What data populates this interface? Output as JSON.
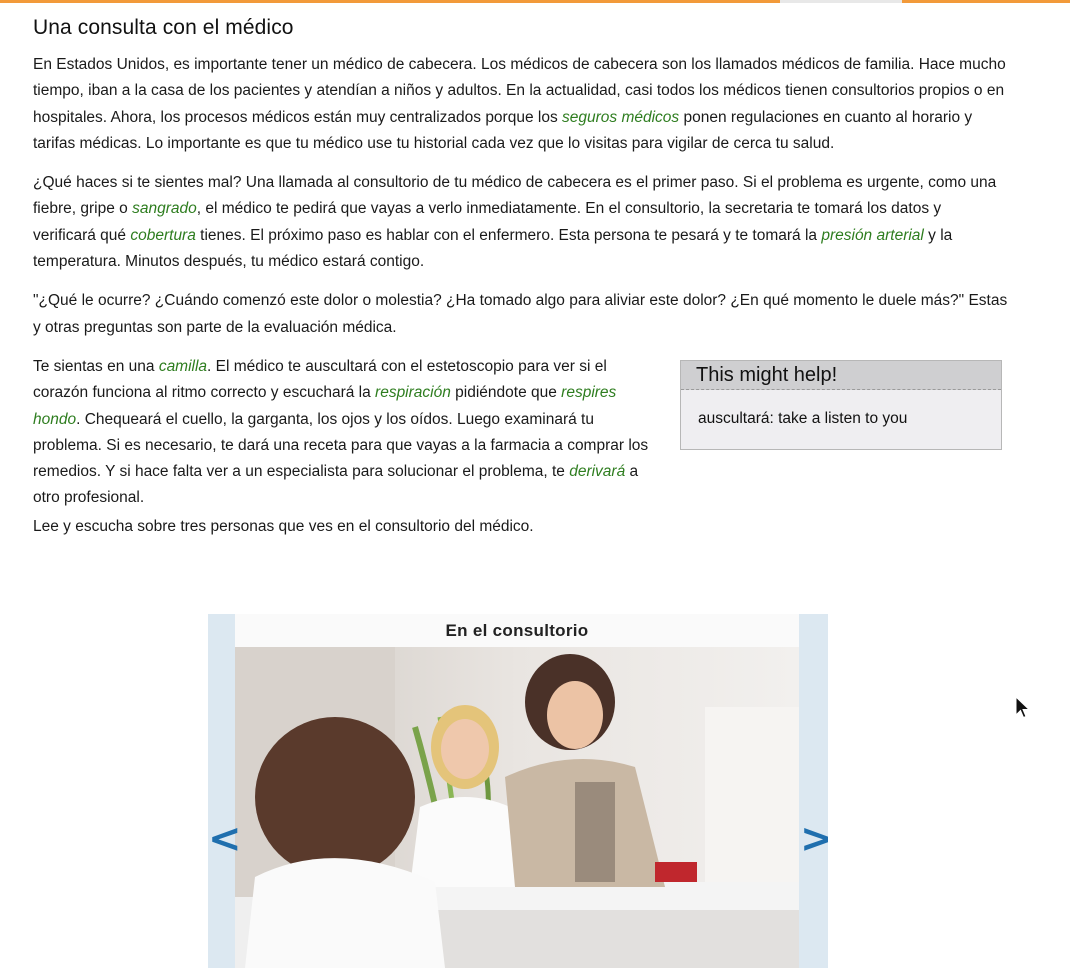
{
  "page": {
    "title": "Una consulta con el médico"
  },
  "paragraphs": {
    "p1": {
      "s1": "En Estados Unidos, es importante tener un médico de cabecera. Los médicos de cabecera son los llamados médicos de familia. Hace mucho tiempo, iban a la casa de los pacientes y atendían a niños y adultos. En la actualidad, casi todos los médicos tienen consultorios propios o en hospitales. Ahora, los procesos médicos están muy centralizados porque los ",
      "g1": "seguros médicos",
      "s2": " ponen regulaciones en cuanto al horario y tarifas médicas. Lo importante es que tu médico use tu historial cada vez que lo visitas para vigilar de cerca tu salud."
    },
    "p2": {
      "s1": "¿Qué haces si te sientes mal? Una llamada al consultorio de tu médico de cabecera es el primer paso. Si el problema es urgente, como una fiebre, gripe o ",
      "g1": "sangrado",
      "s2": ", el médico te pedirá que vayas a verlo inmediatamente. En el consultorio, la secretaria te tomará los datos y verificará qué ",
      "g2": "cobertura",
      "s3": " tienes. El próximo paso es hablar con el enfermero. Esta persona te pesará y te tomará la ",
      "g3": "presión arterial",
      "s4": " y la temperatura. Minutos después, tu médico estará contigo."
    },
    "p3": "\"¿Qué le ocurre? ¿Cuándo comenzó este dolor o molestia? ¿Ha tomado algo para aliviar este dolor? ¿En qué momento le duele más?\" Estas y otras preguntas son parte de la evaluación médica.",
    "p4": {
      "s1": "Te sientas en una ",
      "g1": "camilla",
      "s2": ". El médico te auscultará con el estetoscopio para ver si el corazón funciona al ritmo correcto y escuchará la ",
      "g2": "respiración",
      "s3": " pidiéndote que ",
      "g3": "respires hondo",
      "s4": ". Chequeará el cuello, la garganta, los ojos y los oídos. Luego examinará tu problema. Si es necesario, te dará una receta para que vayas a la farmacia a comprar los remedios. Y si hace falta ver a un especialista para solucionar el problema, te ",
      "g4": "derivará",
      "s5": " a otro profesional."
    },
    "p5": "Lee y escucha sobre tres personas que ves en el consultorio del médico."
  },
  "help_box": {
    "title": "This might help!",
    "text": "auscultará: take a listen to you"
  },
  "slider": {
    "caption": "En el consultorio",
    "prev": "<",
    "next": ">"
  },
  "colors": {
    "accent_orange": "#f29a3a",
    "glossary_green": "#2e7d1f",
    "slider_blue": "#1f6fae"
  }
}
